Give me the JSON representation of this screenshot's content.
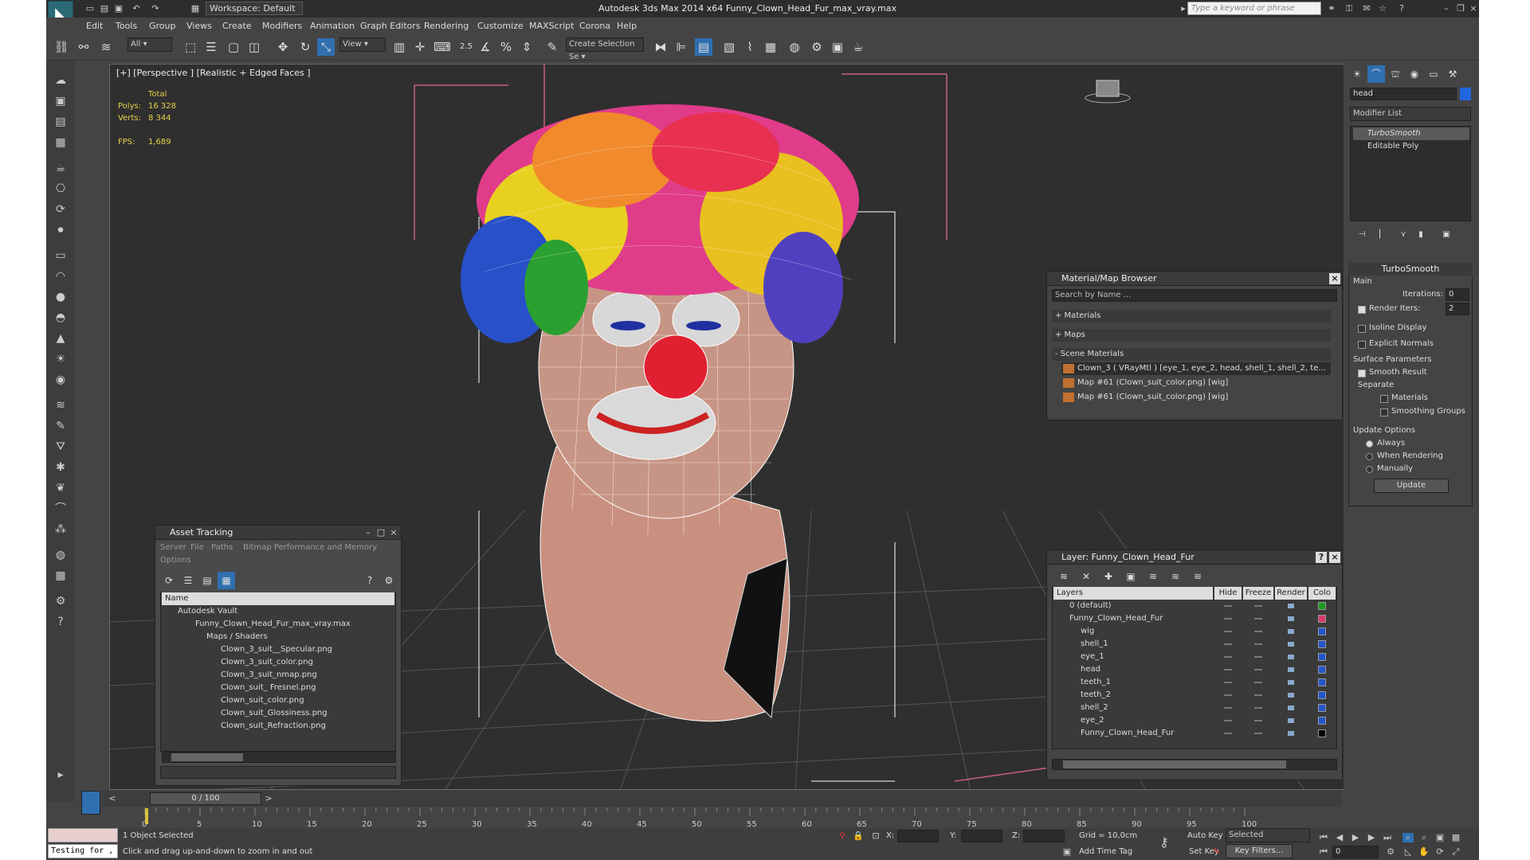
{
  "titlebar": {
    "app_title": "Autodesk 3ds Max  2014 x64",
    "file_title": "Funny_Clown_Head_Fur_max_vray.max",
    "workspace": "Workspace: Default",
    "search_placeholder": "Type a keyword or phrase"
  },
  "menu": [
    "Edit",
    "Tools",
    "Group",
    "Views",
    "Create",
    "Modifiers",
    "Animation",
    "Graph Editors",
    "Rendering",
    "Customize",
    "MAXScript",
    "Corona",
    "Help"
  ],
  "toolbar": {
    "filter_value": "All",
    "refcoord_value": "View",
    "snap_label": "2.5",
    "selection_set_placeholder": "Create Selection Se"
  },
  "viewport": {
    "label": "[+] [Perspective ] [Realistic + Edged Faces ]",
    "stats": {
      "total_label": "Total",
      "polys_label": "Polys:",
      "polys_value": "16 328",
      "verts_label": "Verts:",
      "verts_value": "8 344",
      "fps_label": "FPS:",
      "fps_value": "1,689"
    }
  },
  "command_panel": {
    "object_name": "head",
    "modifier_list": "Modifier List",
    "stack": [
      "TurboSmooth",
      "Editable Poly"
    ],
    "turbosmooth": {
      "title": "TurboSmooth",
      "main_label": "Main",
      "iterations_label": "Iterations:",
      "iterations_value": "0",
      "render_iters_label": "Render Iters:",
      "render_iters_value": "2",
      "isoline_label": "Isoline Display",
      "explicit_normals_label": "Explicit Normals",
      "surface_params_label": "Surface Parameters",
      "smooth_result_label": "Smooth Result",
      "separate_label": "Separate",
      "materials_label": "Materials",
      "smoothing_groups_label": "Smoothing Groups",
      "update_options_label": "Update Options",
      "always_label": "Always",
      "when_rendering_label": "When Rendering",
      "manually_label": "Manually",
      "update_button": "Update"
    }
  },
  "material_browser": {
    "title": "Material/Map Browser",
    "search_placeholder": "Search by Name ...",
    "sections": [
      "+ Materials",
      "+ Maps",
      "- Scene Materials"
    ],
    "items": [
      "Clown_3  ( VRayMtl )  [eye_1, eye_2, head, shell_1, shell_2, te...",
      "Map #61 (Clown_suit_color.png)  [wig]",
      "Map #61 (Clown_suit_color.png)  [wig]"
    ]
  },
  "asset_tracking": {
    "title": "Asset Tracking",
    "menu": [
      "Server",
      "File",
      "Paths",
      "Bitmap Performance and Memory"
    ],
    "options_label": "Options",
    "column_name": "Name",
    "tree": [
      "Autodesk Vault",
      "Funny_Clown_Head_Fur_max_vray.max",
      "Maps / Shaders",
      "Clown_3_suit__Specular.png",
      "Clown_3_suit_color.png",
      "Clown_3_suit_nmap.png",
      "Clown_suit_ Fresnel.png",
      "Clown_suit_color.png",
      "Clown_suit_Glossiness.png",
      "Clown_suit_Refraction.png"
    ]
  },
  "layer_explorer": {
    "title": "Layer: Funny_Clown_Head_Fur",
    "columns": [
      "Layers",
      "Hide",
      "Freeze",
      "Render",
      "Colo"
    ],
    "rows": [
      {
        "name": "0 (default)",
        "color": "#1a9a1a"
      },
      {
        "name": "Funny_Clown_Head_Fur",
        "color": "#d83a6a"
      },
      {
        "name": "wig",
        "color": "#2255cc"
      },
      {
        "name": "shell_1",
        "color": "#2255cc"
      },
      {
        "name": "eye_1",
        "color": "#2255cc"
      },
      {
        "name": "head",
        "color": "#2255cc"
      },
      {
        "name": "teeth_1",
        "color": "#2255cc"
      },
      {
        "name": "teeth_2",
        "color": "#2255cc"
      },
      {
        "name": "shell_2",
        "color": "#2255cc"
      },
      {
        "name": "eye_2",
        "color": "#2255cc"
      },
      {
        "name": "Funny_Clown_Head_Fur",
        "color": "#000000"
      }
    ]
  },
  "timeline": {
    "frame_counter": "0 / 100",
    "ticks": [
      "0",
      "5",
      "10",
      "15",
      "20",
      "25",
      "30",
      "35",
      "40",
      "45",
      "50",
      "55",
      "60",
      "65",
      "70",
      "75",
      "80",
      "85",
      "90",
      "95",
      "100"
    ]
  },
  "status": {
    "maxscript_listener": "Testing for ,",
    "selection": "1 Object Selected",
    "prompt": "Click and drag up-and-down to zoom in and out",
    "x_label": "X:",
    "y_label": "Y:",
    "z_label": "Z:",
    "grid": "Grid = 10,0cm",
    "add_time_tag": "Add Time Tag",
    "auto_key": "Auto Key",
    "set_key": "Set Key",
    "selected_dropdown": "Selected",
    "key_filters": "Key Filters...",
    "current_frame": "0"
  }
}
